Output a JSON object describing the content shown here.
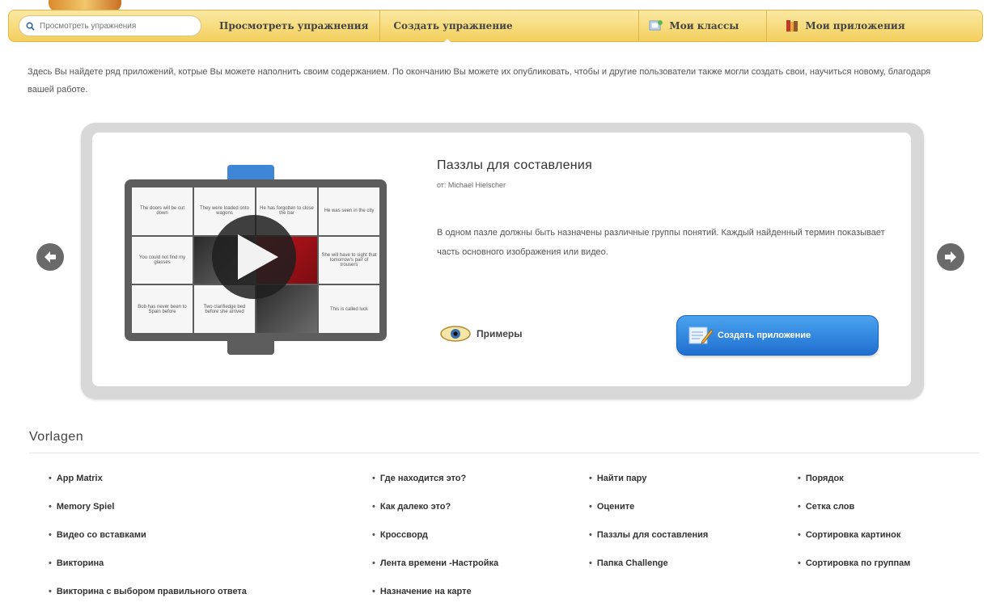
{
  "nav": {
    "search_placeholder": "Просмотреть упражнения",
    "browse_label": "Просмотреть упражнения",
    "create_label": "Создать упражнение",
    "classes_label": "Мои классы",
    "apps_label": "Мои приложения"
  },
  "intro_text": "Здесь Вы найдете ряд приложений, котрые Вы можете наполнить своим содержанием. По окончанию Вы можете их опубликовать, чтобы и другие пользователи также могли создать свои, научиться новому, благодаря вашей работе.",
  "showcase": {
    "title": "Паззлы для составления",
    "author": "от: Michael Hielscher",
    "description": "В одном пазле должны быть назначены различные группы понятий. Каждый найденный термин показывает часть основного изображения или видео.",
    "examples_label": "Примеры",
    "create_button_label": "Создать приложение",
    "preview_cells": [
      "The doors will be cut down",
      "They were loaded onto wagons",
      "He has forgotten to close the bar",
      "He was seen in the city",
      "You could not find my glasses",
      "",
      "",
      "She will have to sight that tomorrow's pair of trousers",
      "Bob has never been to Spain before",
      "Two clarifiedge bed before she arrived",
      "",
      "This is called luck"
    ]
  },
  "templates": {
    "heading": "Vorlagen",
    "col1": [
      "App Matrix",
      "Memory Spiel",
      "Видео со вставками",
      "Викторина",
      "Викторина с выбором правильного ответа"
    ],
    "col2": [
      "Где находится это?",
      "Как далеко это?",
      "Кроссворд",
      "Лента времени -Настройка",
      "Назначение на карте"
    ],
    "col3": [
      "Найти пару",
      "Оцените",
      "Паззлы для составления",
      "Папка Challenge"
    ],
    "col4": [
      "Порядок",
      "Сетка слов",
      "Сортировка картинок",
      "Сортировка по группам"
    ]
  },
  "colors": {
    "nav_bg": "#f3cf5c",
    "button_blue": "#2f86df",
    "preview_tab": "#3f86d6"
  }
}
